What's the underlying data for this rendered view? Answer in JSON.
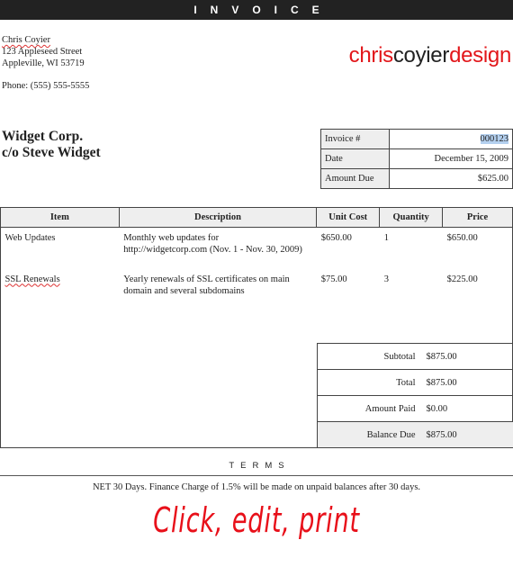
{
  "header": {
    "title": "INVOICE"
  },
  "sender": {
    "name": "Chris Coyier",
    "street": "123 Appleseed Street",
    "city": "Appleville, WI 53719",
    "phone": "Phone: (555) 555-5555"
  },
  "logo": {
    "part1": "chris",
    "part2": "coyier",
    "part3": "design",
    "accent_color": "#e2161a"
  },
  "customer": {
    "line1": "Widget Corp.",
    "line2": "c/o Steve Widget"
  },
  "meta": {
    "invoice_label": "Invoice #",
    "invoice_value": "000123",
    "date_label": "Date",
    "date_value": "December 15, 2009",
    "amount_due_label": "Amount Due",
    "amount_due_value": "$625.00"
  },
  "items": {
    "headers": [
      "Item",
      "Description",
      "Unit Cost",
      "Quantity",
      "Price"
    ],
    "rows": [
      {
        "item": "Web Updates",
        "desc1": "Monthly web updates for",
        "desc2": "http://widgetcorp.com (Nov. 1 - Nov. 30, 2009)",
        "unit_cost": "$650.00",
        "qty": "1",
        "price": "$650.00"
      },
      {
        "item": "SSL Renewals",
        "desc1": "Yearly renewals of SSL certificates on main",
        "desc2": "domain and several subdomains",
        "unit_cost": "$75.00",
        "qty": "3",
        "price": "$225.00"
      }
    ]
  },
  "totals": {
    "subtotal_label": "Subtotal",
    "subtotal_value": "$875.00",
    "total_label": "Total",
    "total_value": "$875.00",
    "paid_label": "Amount Paid",
    "paid_value": "$0.00",
    "balance_label": "Balance Due",
    "balance_value": "$875.00"
  },
  "terms": {
    "title": "TERMS",
    "text": "NET 30 Days. Finance Charge of 1.5% will be made on unpaid balances after 30 days."
  },
  "annotation": "Click, edit, print"
}
